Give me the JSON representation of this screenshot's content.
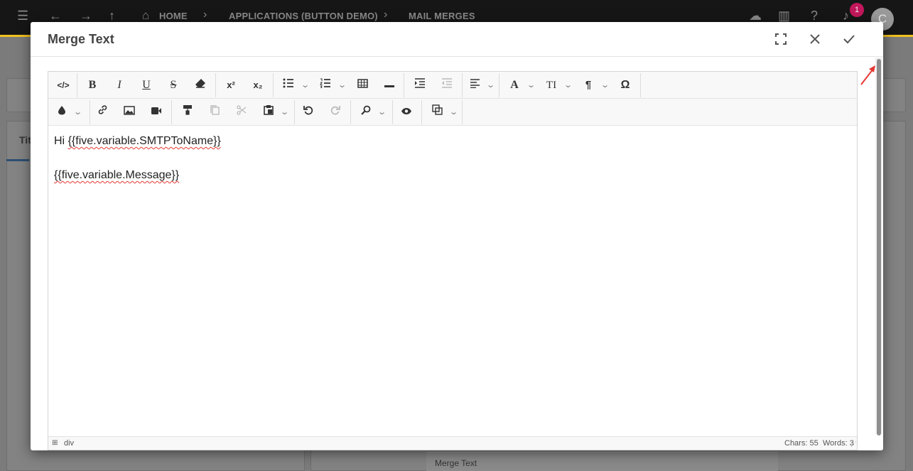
{
  "topbar": {
    "breadcrumbs": [
      "HOME",
      "APPLICATIONS (BUTTON DEMO)",
      "MAIL MERGES"
    ],
    "notification_count": "1",
    "avatar_initial": "C"
  },
  "background": {
    "tab_label": "Tit",
    "merge_text_label": "Merge Text"
  },
  "dialog": {
    "title": "Merge Text",
    "fullscreen_label": "fullscreen-icon",
    "close_label": "close-icon",
    "confirm_label": "check-icon"
  },
  "toolbar": {
    "superscript": "x²",
    "subscript": "x₂",
    "font_size": "TI",
    "paragraph": "¶",
    "special_chars": "Ω"
  },
  "editor": {
    "line1_prefix": "Hi ",
    "line1_var": "{{five.variable.SMTPToName}}",
    "line2_var": "{{five.variable.Message}}"
  },
  "statusbar": {
    "element_path": "div",
    "chars": "Chars: 55",
    "words": "Words: 3"
  },
  "colors": {
    "accent_yellow": "#f0c020",
    "badge_pink": "#c2185b",
    "annotation_red": "#e53935"
  }
}
